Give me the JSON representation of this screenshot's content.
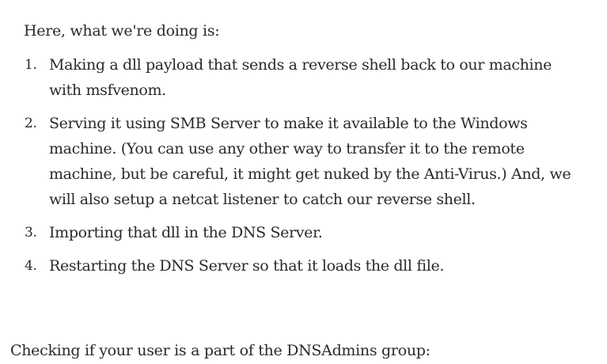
{
  "intro": "Here, what we're doing is:",
  "steps": [
    {
      "number": "1.",
      "text": "Making a dll payload that sends a reverse shell back to our machine with msfvenom."
    },
    {
      "number": "2.",
      "text": "Serving it using SMB Server to make it available to the Windows machine. (You can use any other way to transfer it to the remote machine, but be careful, it might get nuked by the Anti-Virus.) And, we will also setup a netcat listener to catch our reverse shell."
    },
    {
      "number": "3.",
      "text": "Importing that dll in the DNS Server."
    },
    {
      "number": "4.",
      "text": "Restarting the DNS Server so that it loads the dll file."
    }
  ],
  "outro": "Checking if your user is a part of the DNSAdmins group:"
}
